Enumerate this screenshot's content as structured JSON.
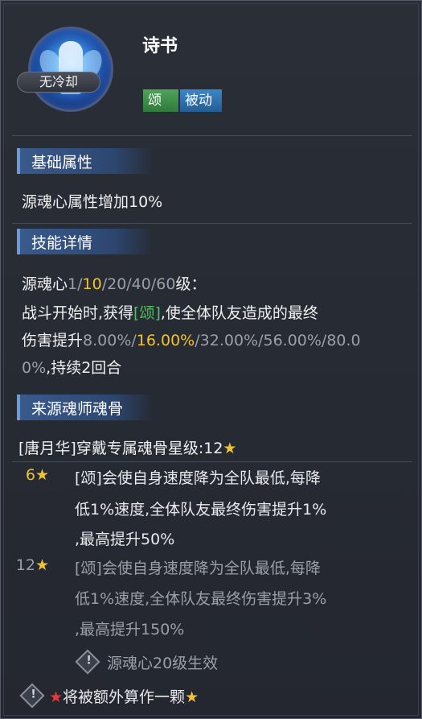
{
  "header": {
    "skill_name": "诗书",
    "cooldown": "无冷却",
    "tags": [
      "颂",
      "被动"
    ]
  },
  "sections": {
    "basic": {
      "title": "基础属性",
      "text": "源魂心属性增加10%"
    },
    "details": {
      "title": "技能详情",
      "level_prefix": "源魂心",
      "level_a": "1/",
      "level_b": "10",
      "level_c": "/20/40/60",
      "level_suffix": "级：",
      "line1_a": "战斗开始时,获得",
      "line1_b": "[颂]",
      "line1_c": ",使全体队友造成的最终",
      "line2_a": "伤害提升",
      "line2_b": "8.00%/",
      "line2_c": "16.00%",
      "line2_d": "/32.00%/56.00%/80.0",
      "line3_a": "0%",
      "line3_b": ",持续2回合"
    },
    "source": {
      "title": "来源魂师魂骨",
      "equip_line": "[唐月华]穿戴专属魂骨星级:12",
      "bonus_6": {
        "num": "6",
        "l1": "[颂]会使自身速度降为全队最低,每降",
        "l2": "低1%速度,全体队友最终伤害提升1%",
        "l3": ",最高提升50%"
      },
      "bonus_12": {
        "num": "12",
        "l1": "[颂]会使自身速度降为全队最低,每降",
        "l2": "低1%速度,全体队友最终伤害提升3%",
        "l3": ",最高提升150%"
      },
      "effect_note": "源魂心20级生效",
      "extra_note": "将被额外算作一颗"
    }
  },
  "icons": {
    "star": "★",
    "warn": "!"
  },
  "colors": {
    "gold": "#f2c230",
    "green": "#4cc25a",
    "dim": "#9aa0aa",
    "tag_song": "#3f9a4b",
    "tag_passive": "#2f73b3"
  }
}
